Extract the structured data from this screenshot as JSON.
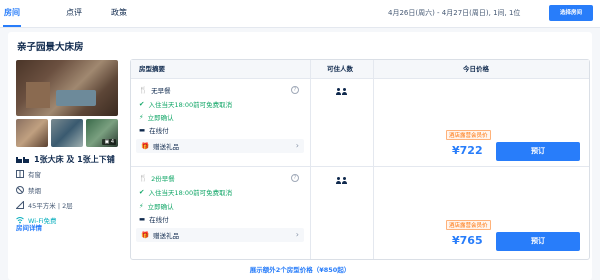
{
  "tabs": [
    "房间",
    "点评",
    "政策"
  ],
  "stay_dates": "4月26日(周六) - 4月27日(周日), 1间, 1位",
  "choose_room_label": "选择房间",
  "room": {
    "title": "亲子园景大床房",
    "photo_count": "4",
    "beds": "1张大床 及 1张上下铺",
    "features": [
      "有窗",
      "禁烟",
      "45平方米 | 2层",
      "Wi-Fi免费"
    ],
    "details_link": "房间详情"
  },
  "table_headers": {
    "summary": "房型摘要",
    "occupancy": "可住人数",
    "price": "今日价格"
  },
  "offers": [
    {
      "meal": "无早餐",
      "cancel": "入住当天18:00前可免费取消",
      "confirm": "立即确认",
      "payment": "在线付",
      "gift": "赠送礼品",
      "promo": "酒店露营会员价",
      "price": "¥722",
      "book_label": "预订"
    },
    {
      "meal": "2份早餐",
      "cancel": "入住当天18:00前可免费取消",
      "confirm": "立即确认",
      "payment": "在线付",
      "gift": "赠送礼品",
      "promo": "酒店露营会员价",
      "price": "¥765",
      "book_label": "预订"
    }
  ],
  "more_options": "展示额外2个房型价格（¥850起）",
  "colors": {
    "accent": "#287dfa",
    "green": "#0ea565",
    "promo": "#ff6f00"
  }
}
